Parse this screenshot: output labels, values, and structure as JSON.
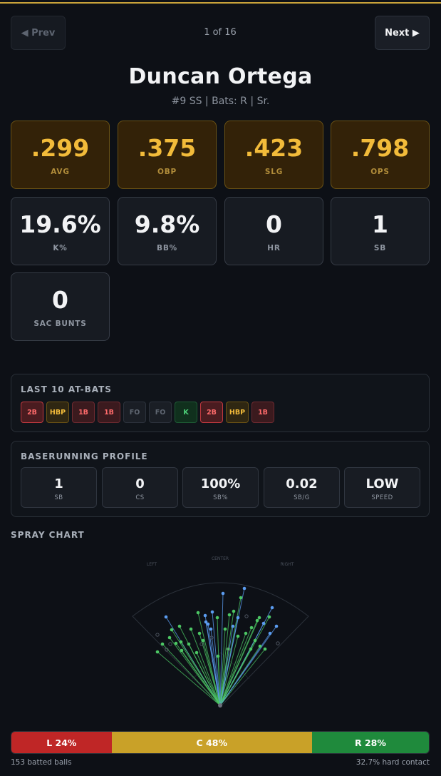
{
  "nav": {
    "prev_label": "◀ Prev",
    "next_label": "Next ▶",
    "counter": "1 of 16"
  },
  "player": {
    "name": "Duncan Ortega",
    "meta": "#9 SS | Bats: R | Sr."
  },
  "stats_primary": [
    {
      "value": ".299",
      "label": "AVG"
    },
    {
      "value": ".375",
      "label": "OBP"
    },
    {
      "value": ".423",
      "label": "SLG"
    },
    {
      "value": ".798",
      "label": "OPS"
    }
  ],
  "stats_secondary": [
    {
      "value": "19.6%",
      "label": "K%"
    },
    {
      "value": "9.8%",
      "label": "BB%"
    },
    {
      "value": "0",
      "label": "HR"
    },
    {
      "value": "1",
      "label": "SB"
    },
    {
      "value": "0",
      "label": "SAC BUNTS"
    }
  ],
  "last_at_bats": {
    "title": "LAST 10 AT-BATS",
    "items": [
      {
        "result": "2B",
        "kind": "xbh"
      },
      {
        "result": "HBP",
        "kind": "hbp"
      },
      {
        "result": "1B",
        "kind": "single"
      },
      {
        "result": "1B",
        "kind": "single"
      },
      {
        "result": "FO",
        "kind": "out"
      },
      {
        "result": "FO",
        "kind": "out"
      },
      {
        "result": "K",
        "kind": "k"
      },
      {
        "result": "2B",
        "kind": "xbh"
      },
      {
        "result": "HBP",
        "kind": "hbp"
      },
      {
        "result": "1B",
        "kind": "single"
      }
    ]
  },
  "baserunning": {
    "title": "BASERUNNING PROFILE",
    "items": [
      {
        "value": "1",
        "label": "SB"
      },
      {
        "value": "0",
        "label": "CS"
      },
      {
        "value": "100%",
        "label": "SB%"
      },
      {
        "value": "0.02",
        "label": "SB/G"
      },
      {
        "value": "LOW",
        "label": "SPEED"
      }
    ]
  },
  "spray_chart": {
    "title": "SPRAY CHART",
    "field_labels": {
      "left": "LEFT",
      "center": "CENTER",
      "right": "RIGHT"
    },
    "colors": {
      "liner": "#5b9cf0",
      "grounder": "#4cc764",
      "fly_out": "#555c68"
    }
  },
  "direction_split": {
    "segments": [
      {
        "label": "L 24%",
        "percent": 24,
        "color": "#bf2626"
      },
      {
        "label": "C 48%",
        "percent": 48,
        "color": "#c9a128"
      },
      {
        "label": "R 28%",
        "percent": 28,
        "color": "#1f8a3c"
      }
    ],
    "batted_balls": "153 batted balls",
    "hard_contact": "32.7% hard contact"
  }
}
